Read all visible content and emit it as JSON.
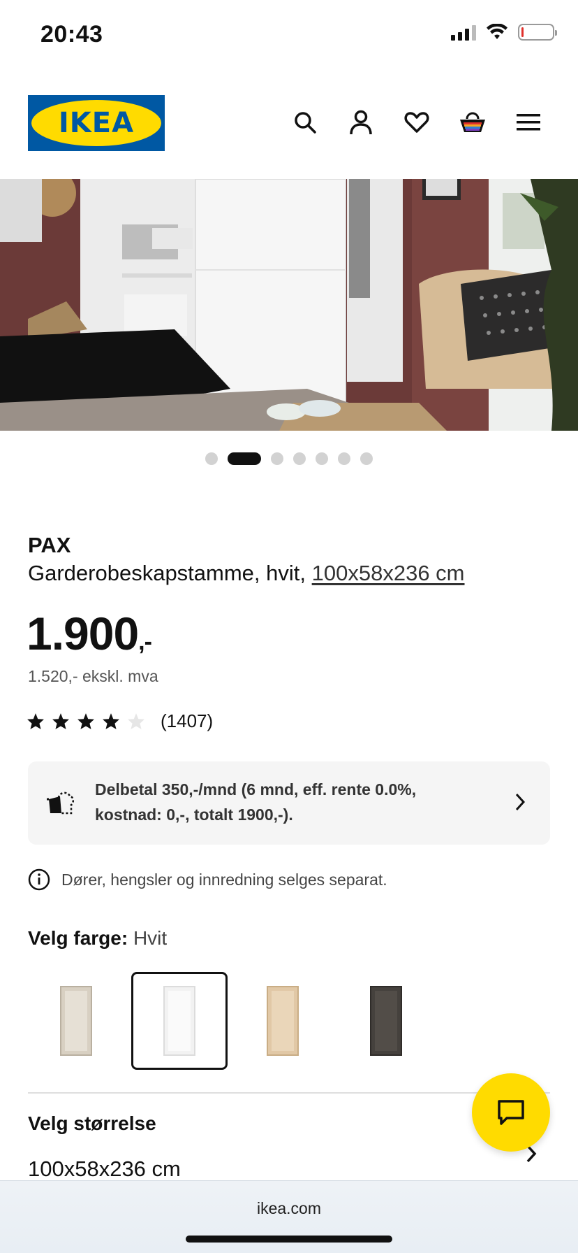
{
  "status_bar": {
    "time": "20:43"
  },
  "header": {
    "logo_text": "IKEA",
    "icons": [
      "search-icon",
      "account-icon",
      "heart-icon",
      "cart-icon",
      "menu-icon"
    ]
  },
  "carousel": {
    "count": 7,
    "active_index": 1
  },
  "product": {
    "name": "PAX",
    "description": "Garderobeskapstamme, hvit,",
    "dimensions_link": "100x58x236 cm",
    "price_main": "1.900",
    "price_suffix": ",-",
    "price_ex_vat": "1.520,- ekskl. mva",
    "rating_value": 4,
    "rating_max": 5,
    "review_count": "(1407)"
  },
  "installment": {
    "text": "Delbetal 350,-/mnd (6 mnd, eff. rente 0.0%, kostnad: 0,-, totalt 1900,-)."
  },
  "info_note": {
    "text": "Dører, hengsler og innredning selges separat."
  },
  "color_picker": {
    "label": "Velg farge:",
    "value": "Hvit",
    "swatches": [
      {
        "color": "#d8d0c2",
        "selected": false
      },
      {
        "color": "#f2f2f2",
        "selected": true
      },
      {
        "color": "#e1c8a6",
        "selected": false
      },
      {
        "color": "#45413d",
        "selected": false
      }
    ]
  },
  "size_picker": {
    "label": "Velg størrelse",
    "value": "100x58x236 cm"
  },
  "browser": {
    "url": "ikea.com"
  },
  "colors": {
    "brand_blue": "#0058a3",
    "brand_yellow": "#ffdb00"
  }
}
